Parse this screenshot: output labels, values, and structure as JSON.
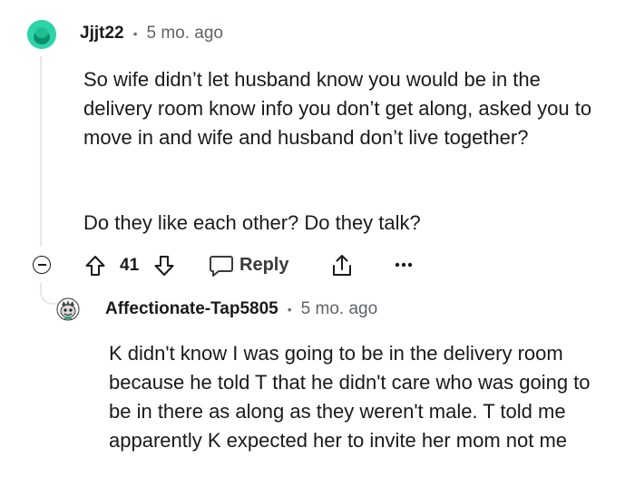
{
  "comment": {
    "username": "Jjjt22",
    "separator": "•",
    "time": "5 mo. ago",
    "paragraphs": [
      "So wife didn’t let husband know you would be in the delivery room know info you don’t get along, asked you to move in and wife and husband don’t live together?",
      "Do they like each other? Do they talk?"
    ],
    "actions": {
      "vote_count": "41",
      "reply_label": "Reply",
      "icons": [
        "collapse-icon",
        "upvote-icon",
        "downvote-icon",
        "reply-icon",
        "share-icon",
        "more-icon"
      ]
    }
  },
  "reply": {
    "username": "Affectionate-Tap5805",
    "separator": "•",
    "time": "5 mo. ago",
    "text": "K didn't know I was going to be in the delivery room because he told T that he didn't care who was going to be in there as along as they weren't male. T told me apparently K expected her to invite her mom not me"
  },
  "colors": {
    "avatar1": "#2dd4a7",
    "text": "#1a1a1b",
    "meta": "#5f6368",
    "thread_line": "#e5e7eb"
  }
}
